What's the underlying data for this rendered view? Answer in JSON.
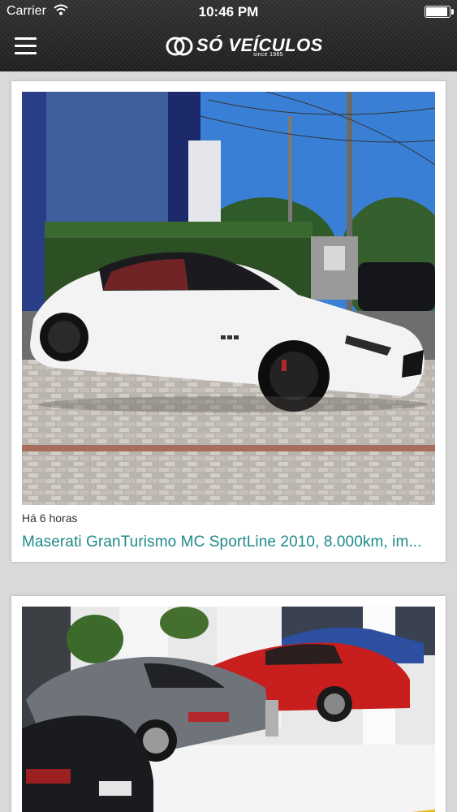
{
  "status_bar": {
    "carrier": "Carrier",
    "time": "10:46 PM",
    "battery_level": 0.95
  },
  "header": {
    "logo_text": "SÓ VEÍCULOS",
    "logo_sub": "since 1985"
  },
  "feed": [
    {
      "time": "Há 6 horas",
      "title": "Maserati GranTurismo MC SportLine 2010, 8.000km, im..."
    },
    {
      "time": "",
      "title": ""
    }
  ],
  "colors": {
    "accent": "#1f8a8a",
    "header_bg": "#232323",
    "page_bg": "#d9d9d9"
  },
  "icons": [
    "menu-icon",
    "wifi-icon",
    "battery-icon",
    "logo-icon"
  ]
}
